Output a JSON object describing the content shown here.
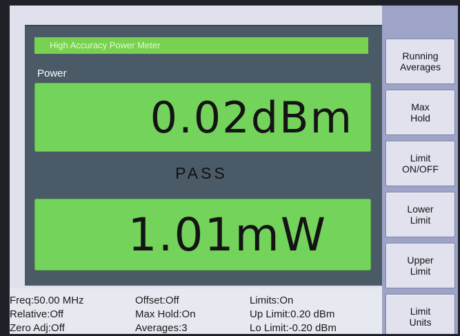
{
  "meter": {
    "title": "High Accuracy Power Meter",
    "power_label": "Power",
    "primary_reading": "0.02dBm",
    "status": "PASS",
    "secondary_reading": "1.01mW"
  },
  "status_bar": {
    "col1": [
      "Freq:50.00 MHz",
      "Relative:Off",
      "Zero Adj:Off"
    ],
    "col2": [
      "Offset:Off",
      "Max Hold:On",
      "Averages:3"
    ],
    "col3": [
      "Limits:On",
      "Up Limit:0.20 dBm",
      "Lo Limit:-0.20 dBm"
    ]
  },
  "softkeys": [
    "Running\nAverages",
    "Max\nHold",
    "Limit\nON/OFF",
    "Lower\nLimit",
    "Upper\nLimit",
    "Limit\nUnits"
  ],
  "colors": {
    "readout_green": "#73d35b",
    "title_green": "#79d24f",
    "panel_slate": "#4a5a66",
    "softkey_column": "#9ea4c7"
  }
}
